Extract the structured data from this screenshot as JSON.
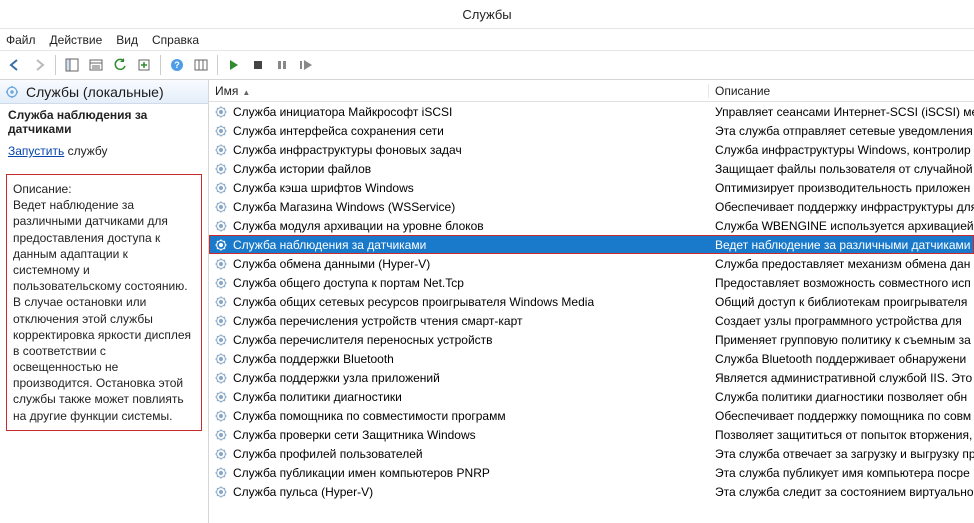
{
  "window": {
    "title": "Службы"
  },
  "menu": {
    "file": "Файл",
    "action": "Действие",
    "view": "Вид",
    "help": "Справка"
  },
  "left": {
    "header": "Службы (локальные)",
    "selected": "Служба наблюдения за датчиками",
    "action_link": "Запустить",
    "action_suffix": "службу",
    "desc_label": "Описание:",
    "desc_text": "Ведет наблюдение за различными датчиками для предоставления доступа к данным адаптации к системному и пользовательскому состоянию.  В случае остановки или отключения этой службы корректировка яркости дисплея в соответствии с освещенностью не производится. Остановка этой службы также может повлиять на другие функции системы."
  },
  "columns": {
    "name": "Имя",
    "desc": "Описание"
  },
  "services": [
    {
      "name": "Служба инициатора Майкрософт iSCSI",
      "desc": "Управляет сеансами Интернет-SCSI (iSCSI) ме"
    },
    {
      "name": "Служба интерфейса сохранения сети",
      "desc": "Эта служба отправляет сетевые уведомления"
    },
    {
      "name": "Служба инфраструктуры фоновых задач",
      "desc": "Служба инфраструктуры Windows, контролир"
    },
    {
      "name": "Служба истории файлов",
      "desc": "Защищает файлы пользователя от случайной"
    },
    {
      "name": "Служба кэша шрифтов Windows",
      "desc": "Оптимизирует производительность приложен"
    },
    {
      "name": "Служба Магазина Windows (WSService)",
      "desc": "Обеспечивает поддержку инфраструктуры для"
    },
    {
      "name": "Служба модуля архивации на уровне блоков",
      "desc": "Служба WBENGINE используется архивацией д"
    },
    {
      "name": "Служба наблюдения за датчиками",
      "desc": "Ведет наблюдение за различными датчиками "
    },
    {
      "name": "Служба обмена данными (Hyper-V)",
      "desc": "Служба предоставляет механизм обмена дан"
    },
    {
      "name": "Служба общего доступа к портам Net.Tcp",
      "desc": "Предоставляет возможность совместного исп"
    },
    {
      "name": "Служба общих сетевых ресурсов проигрывателя Windows Media",
      "desc": "Общий доступ к библиотекам проигрывателя "
    },
    {
      "name": "Служба перечисления устройств чтения смарт-карт",
      "desc": "Создает узлы программного устройства для "
    },
    {
      "name": "Служба перечислителя переносных устройств",
      "desc": "Применяет групповую политику к съемным за"
    },
    {
      "name": "Служба поддержки Bluetooth",
      "desc": "Служба Bluetooth поддерживает обнаружени"
    },
    {
      "name": "Служба поддержки узла приложений",
      "desc": "Является административной службой IIS. Этo"
    },
    {
      "name": "Служба политики диагностики",
      "desc": "Служба политики диагностики позволяет обн"
    },
    {
      "name": "Служба помощника по совместимости программ",
      "desc": "Обеспечивает поддержку помощника по совм"
    },
    {
      "name": "Служба проверки сети Защитника Windows",
      "desc": "Позволяет защититься от попыток вторжения,"
    },
    {
      "name": "Служба профилей пользователей",
      "desc": "Эта служба отвечает за загрузку и выгрузку про"
    },
    {
      "name": "Служба публикации имен компьютеров PNRP",
      "desc": "Эта служба публикует имя компьютера посре"
    },
    {
      "name": "Служба пульса (Hyper-V)",
      "desc": "Эта служба следит за состоянием виртуальног"
    }
  ],
  "selected_index": 7
}
